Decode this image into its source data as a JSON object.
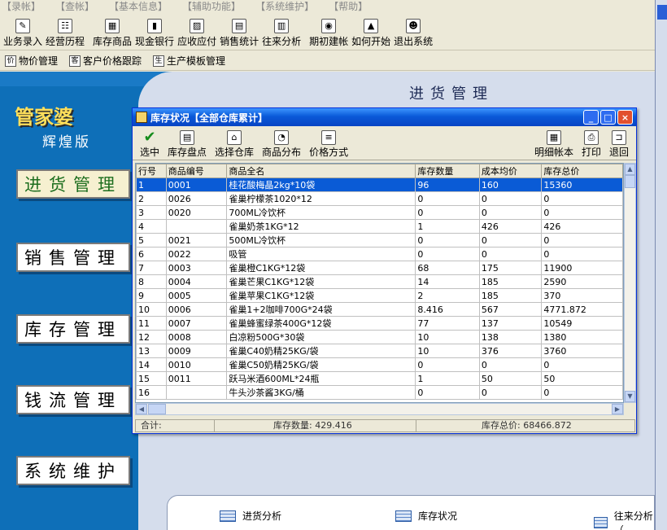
{
  "menu": [
    "【录帐】",
    "【查帐】",
    "【基本信息】",
    "【辅助功能】",
    "【系统维护】",
    "【帮助】"
  ],
  "toolbar": [
    {
      "label": "业务录入",
      "icon": "entry-icon"
    },
    {
      "label": "经营历程",
      "icon": "history-icon"
    },
    {
      "label": "库存商品",
      "icon": "inventory-icon"
    },
    {
      "label": "现金银行",
      "icon": "cash-icon"
    },
    {
      "label": "应收应付",
      "icon": "payable-icon"
    },
    {
      "label": "销售统计",
      "icon": "stats-icon"
    },
    {
      "label": "往来分析",
      "icon": "analysis-icon"
    },
    {
      "label": "期初建帐",
      "icon": "setup-icon"
    },
    {
      "label": "如何开始",
      "icon": "help-icon"
    },
    {
      "label": "退出系统",
      "icon": "exit-icon"
    }
  ],
  "toolbar2": [
    "物价管理",
    "客户价格跟踪",
    "生产模板管理"
  ],
  "app": {
    "logo": "管家婆",
    "edition": "辉煌版",
    "header": "进货管理",
    "nav": [
      "进货管理",
      "销售管理",
      "库存管理",
      "钱流管理",
      "系统维护"
    ],
    "bottom_tabs": [
      "进货分析",
      "库存状况",
      "往来分析（"
    ]
  },
  "window": {
    "title": "库存状况【全部仓库累计】",
    "tools_left": [
      "选中",
      "库存盘点",
      "选择仓库",
      "商品分布",
      "价格方式"
    ],
    "tools_right": [
      "明细帐本",
      "打印",
      "退回"
    ],
    "columns": [
      "行号",
      "商品编号",
      "商品全名",
      "库存数量",
      "成本均价",
      "库存总价"
    ],
    "rows": [
      [
        "1",
        "0001",
        "桂花酸梅晶2kg*10袋",
        "96",
        "160",
        "15360"
      ],
      [
        "2",
        "0026",
        "雀巢柠檬茶1020*12",
        "0",
        "0",
        "0"
      ],
      [
        "3",
        "0020",
        "700ML冷饮杯",
        "0",
        "0",
        "0"
      ],
      [
        "4",
        "",
        "雀巢奶茶1KG*12",
        "1",
        "426",
        "426"
      ],
      [
        "5",
        "0021",
        "500ML冷饮杯",
        "0",
        "0",
        "0"
      ],
      [
        "6",
        "0022",
        "吸管",
        "0",
        "0",
        "0"
      ],
      [
        "7",
        "0003",
        "雀巢橙C1KG*12袋",
        "68",
        "175",
        "11900"
      ],
      [
        "8",
        "0004",
        "雀巢芒果C1KG*12袋",
        "14",
        "185",
        "2590"
      ],
      [
        "9",
        "0005",
        "雀巢苹果C1KG*12袋",
        "2",
        "185",
        "370"
      ],
      [
        "10",
        "0006",
        "雀巢1+2咖啡700G*24袋",
        "8.416",
        "567",
        "4771.872"
      ],
      [
        "11",
        "0007",
        "雀巢蜂蜜绿茶400G*12袋",
        "77",
        "137",
        "10549"
      ],
      [
        "12",
        "0008",
        "白凉粉500G*30袋",
        "10",
        "138",
        "1380"
      ],
      [
        "13",
        "0009",
        "雀巢C40奶精25KG/袋",
        "10",
        "376",
        "3760"
      ],
      [
        "14",
        "0010",
        "雀巢C50奶精25KG/袋",
        "0",
        "0",
        "0"
      ],
      [
        "15",
        "0011",
        "跃马米酒600ML*24瓶",
        "1",
        "50",
        "50"
      ],
      [
        "16",
        "",
        "牛头沙茶酱3KG/桶",
        "0",
        "0",
        "0"
      ]
    ],
    "status": {
      "total_label": "合计:",
      "qty_label": "库存数量:",
      "qty": "429.416",
      "value_label": "库存总价:",
      "value": "68466.872"
    }
  }
}
